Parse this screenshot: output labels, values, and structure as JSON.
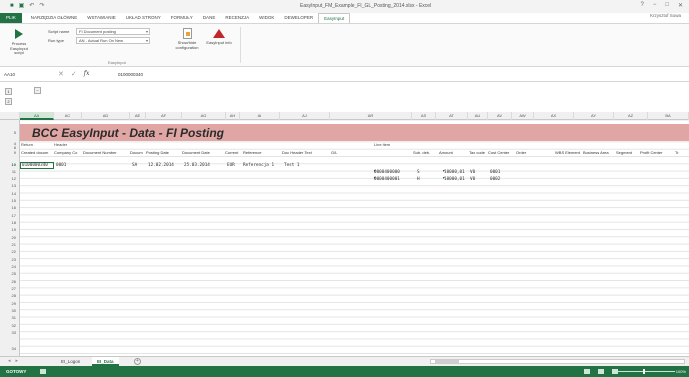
{
  "window": {
    "title": "EasyInput_FM_Example_FI_GL_Posting_2014.xlsx - Excel",
    "controls": [
      "?",
      "−",
      "□",
      "✕"
    ],
    "user": "Krzysztof Sowa"
  },
  "ribbon_tabs": [
    "PLIK",
    "NARZĘDZIA GŁÓWNE",
    "WSTAWIANIE",
    "UKŁAD STRONY",
    "FORMUŁY",
    "DANE",
    "RECENZJA",
    "WIDOK",
    "DEWELOPER",
    "EasyInput"
  ],
  "ribbon": {
    "process_label": "Process EasyInput script",
    "script_name_label": "Script name",
    "script_name_value": "FI Document posting",
    "run_type_label": "Run type",
    "run_type_value": "AN - Actual Run On New",
    "show_hide_label": "Show/hide configuration",
    "info_label": "EasyInput info",
    "group_label": "EasyInput"
  },
  "formula_bar": {
    "name_box": "AA10",
    "formula": "0100000340",
    "cancel": "✕",
    "enter": "✓",
    "fx": "fx"
  },
  "outline_buttons": [
    "1",
    "2",
    "−"
  ],
  "columns": [
    "AA",
    "AC",
    "AD",
    "AE",
    "AF",
    "AG",
    "AH",
    "AI",
    "AJ",
    "AR",
    "AS",
    "AT",
    "AU",
    "AV",
    "AW",
    "AX",
    "AY",
    "AZ",
    "BA"
  ],
  "selected_column": "AA",
  "rows": [
    "4",
    "5",
    "8",
    "9",
    "10",
    "11",
    "12",
    "13",
    "14",
    "15",
    "16",
    "17",
    "18",
    "19",
    "20",
    "21",
    "22",
    "23",
    "24",
    "25",
    "26",
    "27",
    "28",
    "29",
    "30",
    "31",
    "32",
    "33",
    "34"
  ],
  "selected_row": "10",
  "sheet": {
    "banner_title": "BCC EasyInput - Data - FI Posting",
    "return_label": "Return",
    "header_group": "Header",
    "line_item_group": "Line item",
    "headers": [
      "Created docum",
      "Company Co",
      "Document Number",
      "Docum",
      "Posting Date",
      "Document Date",
      "Current",
      "Reference",
      "Doc Header Text",
      "G/L",
      "Sub. deb.",
      "Amount",
      "Tax code",
      "Cost Center",
      "Order",
      "WBS Element",
      "Business Area",
      "Segment",
      "Profit Center",
      "Tr"
    ],
    "row10": {
      "created_doc": "0100000340",
      "company_code": "0001",
      "doc_type": "SA",
      "posting_date": "12.02.2014",
      "document_date": "25.03.2014",
      "currency": "EUR",
      "reference": "Referencja 1",
      "header_text": "Test 1"
    },
    "line_items": [
      {
        "gl": "0000400000",
        "sub": "S",
        "amount": "10000,01",
        "tax": "V0",
        "cost_center": "0001"
      },
      {
        "gl": "0000400001",
        "sub": "H",
        "amount": "10000,01",
        "tax": "V0",
        "cost_center": "0002"
      }
    ]
  },
  "sheet_tabs": [
    "EI_Logon",
    "EI_Data"
  ],
  "active_sheet": "EI_Data",
  "add_sheet": "+",
  "status": {
    "text": "GOTOWY",
    "zoom": "100%"
  }
}
